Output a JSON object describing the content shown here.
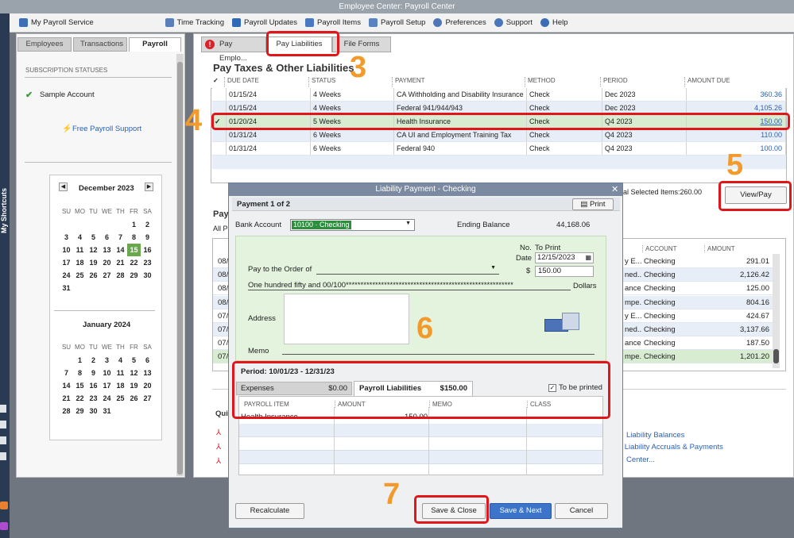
{
  "window": {
    "title": "Employee Center: Payroll Center"
  },
  "toolbar": {
    "items": [
      "My Payroll Service",
      "Time Tracking",
      "Payroll Updates",
      "Payroll Items",
      "Payroll Setup",
      "Preferences",
      "Support",
      "Help"
    ]
  },
  "left": {
    "tabs": [
      "Employees",
      "Transactions",
      "Payroll"
    ],
    "section_title": "SUBSCRIPTION STATUSES",
    "account": "Sample Account",
    "support_link": "Free Payroll Support",
    "shortcuts_label": "My Shortcuts",
    "cal1": {
      "month": "December 2023",
      "days_header": [
        "SU",
        "MO",
        "TU",
        "WE",
        "TH",
        "FR",
        "SA"
      ],
      "weeks": [
        [
          "",
          "",
          "",
          "",
          "",
          "1",
          "2"
        ],
        [
          "3",
          "4",
          "5",
          "6",
          "7",
          "8",
          "9"
        ],
        [
          "10",
          "11",
          "12",
          "13",
          "14",
          "15",
          "16"
        ],
        [
          "17",
          "18",
          "19",
          "20",
          "21",
          "22",
          "23"
        ],
        [
          "24",
          "25",
          "26",
          "27",
          "28",
          "29",
          "30"
        ],
        [
          "31",
          "",
          "",
          "",
          "",
          "",
          ""
        ]
      ],
      "today": "15"
    },
    "cal2": {
      "month": "January 2024",
      "weeks": [
        [
          "",
          "1",
          "2",
          "3",
          "4",
          "5",
          "6"
        ],
        [
          "7",
          "8",
          "9",
          "10",
          "11",
          "12",
          "13"
        ],
        [
          "14",
          "15",
          "16",
          "17",
          "18",
          "19",
          "20"
        ],
        [
          "21",
          "22",
          "23",
          "24",
          "25",
          "26",
          "27"
        ],
        [
          "28",
          "29",
          "30",
          "31",
          "",
          "",
          ""
        ]
      ]
    }
  },
  "main": {
    "tabs": [
      "Pay Emplo...",
      "Pay Liabilities",
      "File Forms"
    ],
    "heading": "Pay Taxes & Other Liabilities",
    "columns": [
      "✓",
      "DUE DATE",
      "STATUS",
      "PAYMENT",
      "METHOD",
      "PERIOD",
      "AMOUNT DUE"
    ],
    "rows": [
      {
        "check": "",
        "due": "01/15/24",
        "status": "4 Weeks",
        "payment": "CA Withholding and Disability Insurance",
        "method": "Check",
        "period": "Dec 2023",
        "amount": "360.36"
      },
      {
        "check": "",
        "due": "01/15/24",
        "status": "4 Weeks",
        "payment": "Federal 941/944/943",
        "method": "Check",
        "period": "Dec 2023",
        "amount": "4,105.26"
      },
      {
        "check": "✓",
        "due": "01/20/24",
        "status": "5 Weeks",
        "payment": "Health Insurance",
        "method": "Check",
        "period": "Q4 2023",
        "amount": "150.00"
      },
      {
        "check": "",
        "due": "01/31/24",
        "status": "6 Weeks",
        "payment": "CA UI and Employment Training Tax",
        "method": "Check",
        "period": "Q4 2023",
        "amount": "110.00"
      },
      {
        "check": "",
        "due": "01/31/24",
        "status": "6 Weeks",
        "payment": "Federal 940",
        "method": "Check",
        "period": "Q4 2023",
        "amount": "100.00"
      }
    ],
    "total_selected": "al Selected Items:260.00",
    "view_pay": "View/Pay",
    "pay_label": "Pay",
    "all_label": "All P",
    "lower_columns": [
      "ACCOUNT",
      "AMOUNT"
    ],
    "lower_rows": [
      {
        "left": "08/",
        "desc": "y E...",
        "account": "Checking",
        "amount": "291.01"
      },
      {
        "left": "08/",
        "desc": "ned...",
        "account": "Checking",
        "amount": "2,126.42"
      },
      {
        "left": "08/",
        "desc": "ance",
        "account": "Checking",
        "amount": "125.00"
      },
      {
        "left": "08/",
        "desc": "mpe...",
        "account": "Checking",
        "amount": "804.16"
      },
      {
        "left": "07/",
        "desc": "y E...",
        "account": "Checking",
        "amount": "424.67"
      },
      {
        "left": "07/",
        "desc": "ned...",
        "account": "Checking",
        "amount": "3,137.66"
      },
      {
        "left": "07/",
        "desc": "ance",
        "account": "Checking",
        "amount": "187.50"
      },
      {
        "left": "07/",
        "desc": "mpe...",
        "account": "Checking",
        "amount": "1,201.20"
      }
    ],
    "quick_label": "Qui",
    "links": [
      "Liability Balances",
      "l Liability Accruals & Payments",
      "Center..."
    ]
  },
  "dialog": {
    "title": "Liability Payment - Checking",
    "payment_of": "Payment 1 of 2",
    "print": "Print",
    "bank_label": "Bank Account",
    "bank_value": "10100 · Checking",
    "ending_label": "Ending Balance",
    "ending_value": "44,168.06",
    "no_label": "No.",
    "no_value": "To Print",
    "date_label": "Date",
    "date_value": "12/15/2023",
    "dollar_sign": "$",
    "amount_value": "150.00",
    "payto_label": "Pay to the Order of",
    "words": "One hundred fifty and 00/100*********************************************************",
    "dollars": "Dollars",
    "address_label": "Address",
    "memo_label": "Memo",
    "period": "Period: 10/01/23 - 12/31/23",
    "tab_expenses": "Expenses",
    "tab_expenses_amt": "$0.00",
    "tab_liabilities": "Payroll Liabilities",
    "tab_liabilities_amt": "$150.00",
    "to_be_printed": "To be printed",
    "ptable_cols": [
      "PAYROLL ITEM",
      "AMOUNT",
      "MEMO",
      "CLASS"
    ],
    "ptable_row": {
      "item": "Health Insurance",
      "amount": "150.00"
    },
    "buttons": {
      "recalculate": "Recalculate",
      "save_close": "Save & Close",
      "save_next": "Save & Next",
      "cancel": "Cancel"
    }
  },
  "callouts": [
    "3",
    "4",
    "5",
    "6",
    "7"
  ],
  "colors": {
    "accent": "#e0161b",
    "number": "#f39a2d",
    "link": "#2b61b3",
    "today": "#6aa84f"
  }
}
